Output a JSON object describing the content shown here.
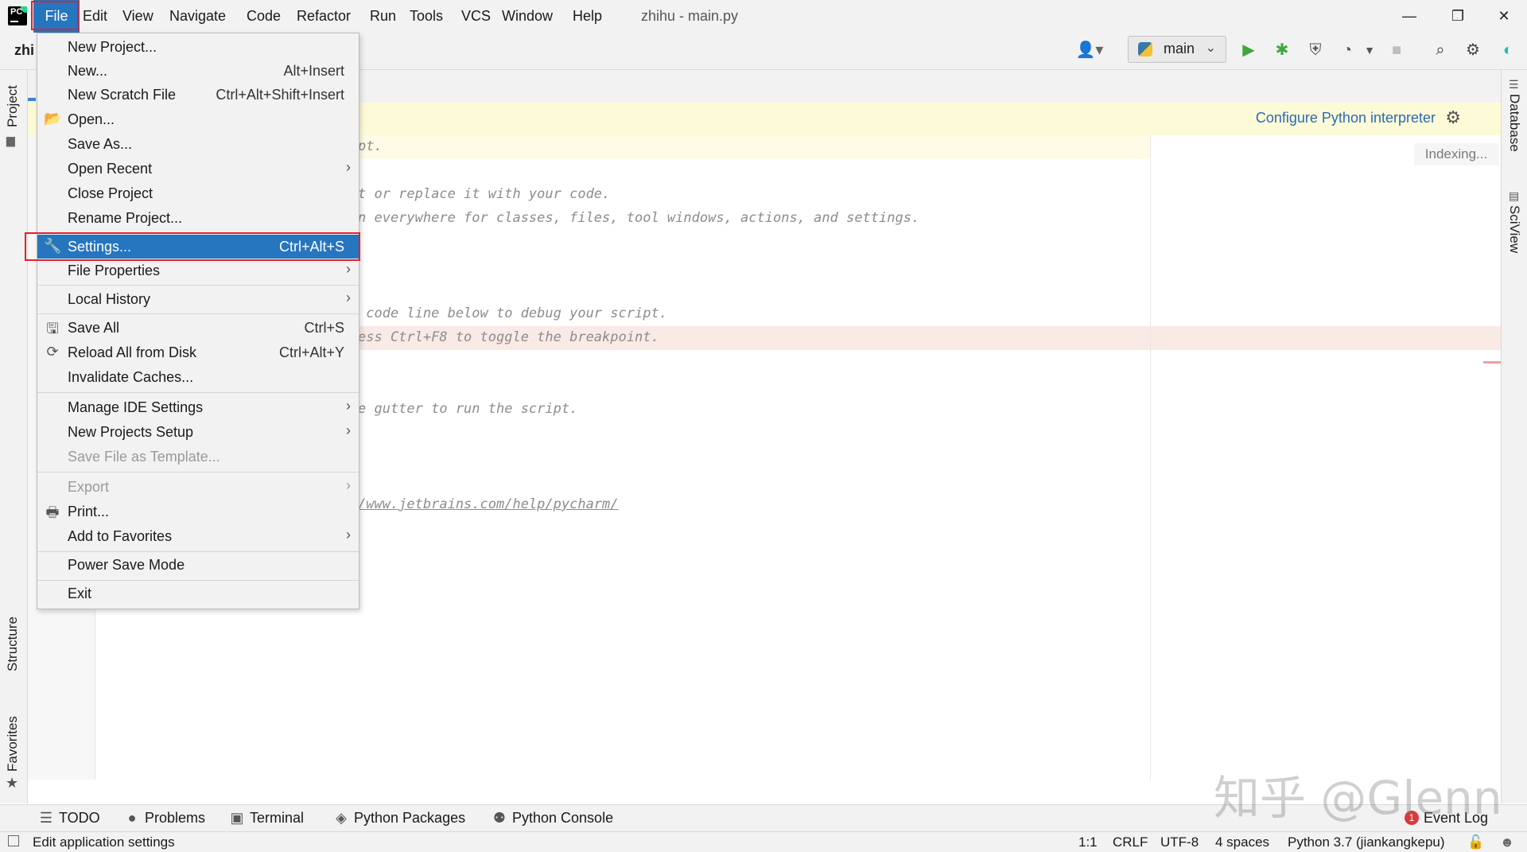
{
  "window": {
    "title": "zhihu - main.py",
    "controls": {
      "minimize": "—",
      "restore": "❐",
      "close": "✕"
    }
  },
  "menubar": {
    "items": [
      "File",
      "Edit",
      "View",
      "Navigate",
      "Code",
      "Refactor",
      "Run",
      "Tools",
      "VCS",
      "Window",
      "Help"
    ]
  },
  "toolbar": {
    "project_name": "zhi",
    "run_config": "main"
  },
  "left_stripe": {
    "project": "Project",
    "structure": "Structure",
    "favorites": "Favorites"
  },
  "right_stripe": {
    "database": "Database",
    "sciview": "SciView"
  },
  "banner": {
    "link": "Configure Python interpreter"
  },
  "editor": {
    "indexing": "Indexing...",
    "lines": [
      "pt.",
      "t or replace it with your code.",
      "n everywhere for classes, files, tool windows, actions, and settings.",
      " code line below to debug your script.",
      "ess Ctrl+F8 to toggle the breakpoint.",
      "e gutter to run the script.",
      "/www.jetbrains.com/help/pycharm/"
    ]
  },
  "file_menu": {
    "new_project": "New Project...",
    "new": "New...",
    "new_sc": "Alt+Insert",
    "new_scratch": "New Scratch File",
    "new_scratch_sc": "Ctrl+Alt+Shift+Insert",
    "open": "Open...",
    "save_as": "Save As...",
    "open_recent": "Open Recent",
    "close_project": "Close Project",
    "rename_project": "Rename Project...",
    "settings": "Settings...",
    "settings_sc": "Ctrl+Alt+S",
    "file_properties": "File Properties",
    "local_history": "Local History",
    "save_all": "Save All",
    "save_all_sc": "Ctrl+S",
    "reload": "Reload All from Disk",
    "reload_sc": "Ctrl+Alt+Y",
    "invalidate": "Invalidate Caches...",
    "manage_ide": "Manage IDE Settings",
    "new_projects_setup": "New Projects Setup",
    "save_template": "Save File as Template...",
    "export": "Export",
    "print": "Print...",
    "add_favorites": "Add to Favorites",
    "power_save": "Power Save Mode",
    "exit": "Exit"
  },
  "bottom_bar": {
    "todo": "TODO",
    "problems": "Problems",
    "terminal": "Terminal",
    "python_packages": "Python Packages",
    "python_console": "Python Console",
    "event_log": "Event Log",
    "event_count": "1"
  },
  "status_bar": {
    "message": "Edit application settings",
    "position": "1:1",
    "line_sep": "CRLF",
    "encoding": "UTF-8",
    "indent": "4 spaces",
    "interpreter": "Python 3.7 (jiankangkepu)"
  },
  "watermark": "知乎 @Glenn"
}
